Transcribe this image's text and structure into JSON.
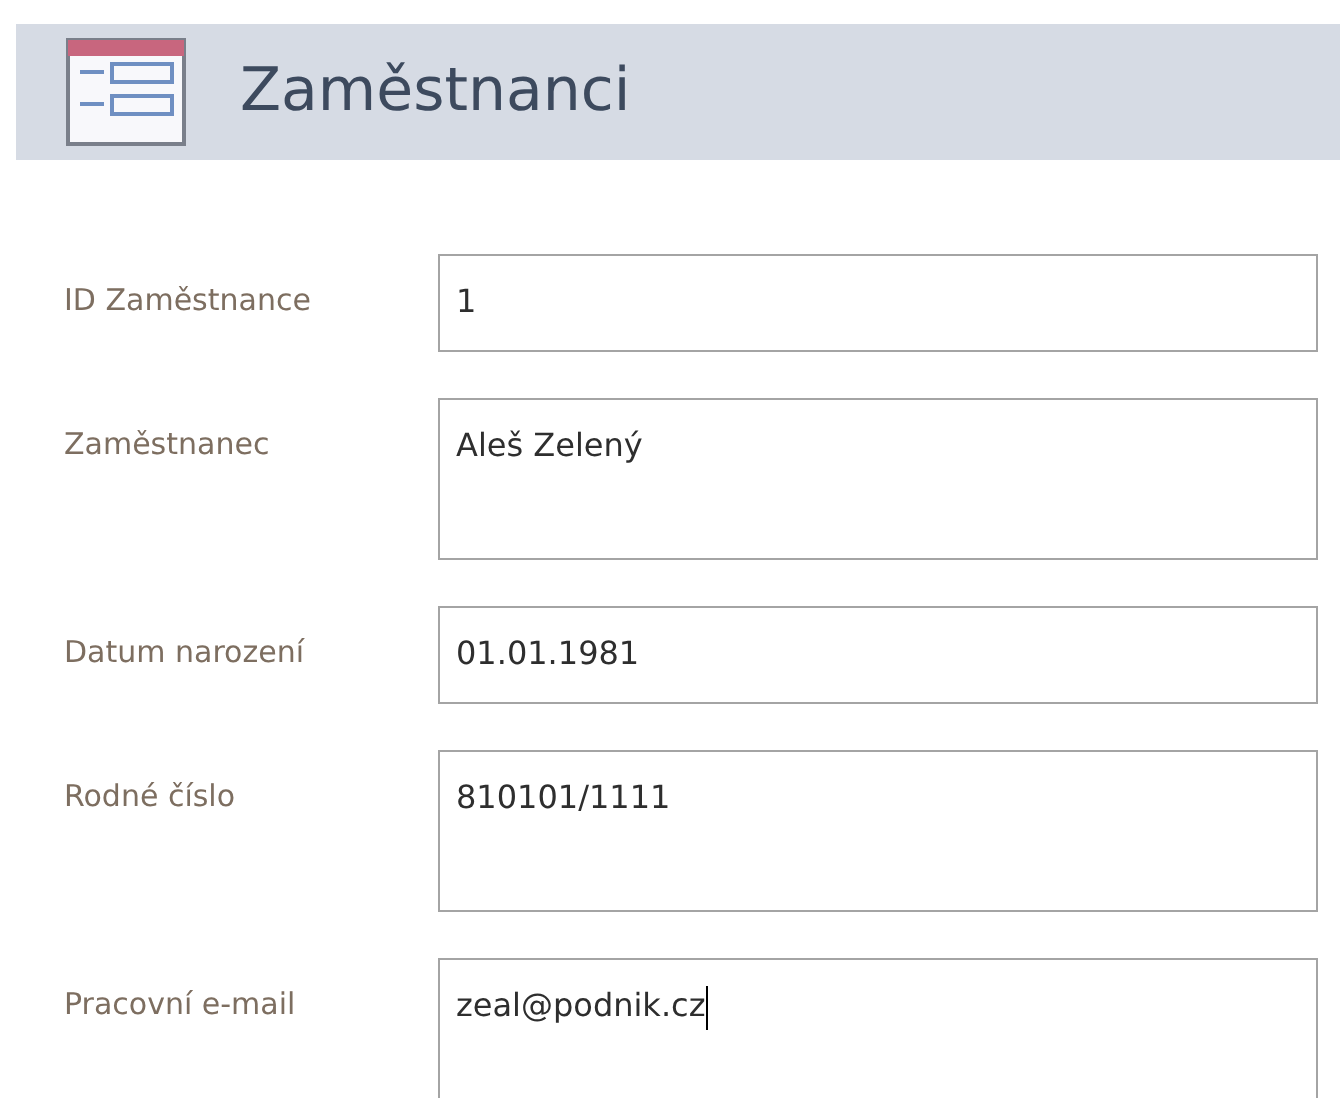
{
  "header": {
    "title": "Zaměstnanci"
  },
  "fields": [
    {
      "label": "ID Zaměstnance",
      "value": "1",
      "kind": "single",
      "focused": false
    },
    {
      "label": "Zaměstnanec",
      "value": "Aleš Zelený",
      "kind": "multi",
      "focused": false
    },
    {
      "label": "Datum narození",
      "value": "01.01.1981",
      "kind": "single",
      "focused": false
    },
    {
      "label": "Rodné číslo",
      "value": "810101/1111",
      "kind": "multi",
      "focused": false
    },
    {
      "label": "Pracovní e-mail",
      "value": "zeal@podnik.cz",
      "kind": "cut",
      "focused": true
    }
  ]
}
